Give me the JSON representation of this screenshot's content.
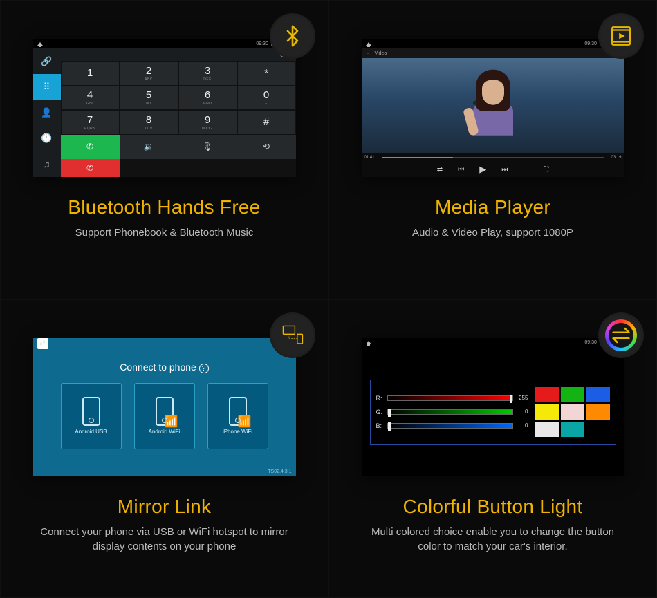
{
  "status": {
    "time": "09:30"
  },
  "cells": {
    "bt": {
      "title": "Bluetooth Hands Free",
      "subtitle": "Support Phonebook & Bluetooth Music",
      "keys": [
        {
          "big": "1",
          "sm": ""
        },
        {
          "big": "2",
          "sm": "ABC"
        },
        {
          "big": "3",
          "sm": "DEF"
        },
        {
          "big": "*",
          "sm": ""
        },
        {
          "big": "4",
          "sm": "GHI"
        },
        {
          "big": "5",
          "sm": "JKL"
        },
        {
          "big": "6",
          "sm": "MNO"
        },
        {
          "big": "0",
          "sm": "+"
        },
        {
          "big": "7",
          "sm": "PQRS"
        },
        {
          "big": "8",
          "sm": "TUV"
        },
        {
          "big": "9",
          "sm": "WXYZ"
        },
        {
          "big": "#",
          "sm": ""
        }
      ]
    },
    "media": {
      "title": "Media Player",
      "subtitle": "Audio & Video Play, support 1080P",
      "video_label": "Video",
      "elapsed": "01:41",
      "duration": "03:19",
      "progress_pct": 32
    },
    "mirror": {
      "title": "Mirror Link",
      "subtitle": "Connect your phone via USB or WiFi hotspot to mirror display contents on your phone",
      "heading": "Connect to phone",
      "options": [
        "Android USB",
        "Android WiFi",
        "iPhone WiFi"
      ],
      "version": "TS02.4.3.1"
    },
    "color": {
      "title": "Colorful Button Light",
      "subtitle": "Multi colored choice enable you to change the button color to match your car's interior.",
      "r_label": "R:",
      "g_label": "G:",
      "b_label": "B:",
      "r": 255,
      "g": 0,
      "b": 0,
      "swatches": [
        "#e51b1b",
        "#14b314",
        "#1b5ee5",
        "#f5e90a",
        "#f2d6d6",
        "#ff8a00",
        "#e8e8e8",
        "#0aa6a6",
        "#000000"
      ]
    }
  }
}
